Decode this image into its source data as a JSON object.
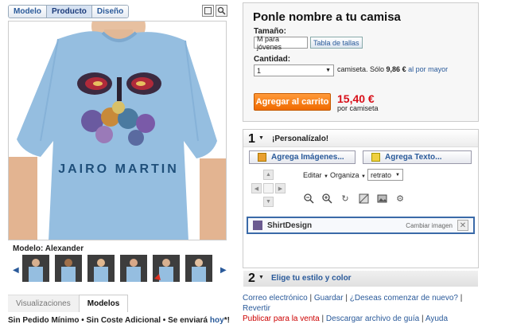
{
  "view_tabs": [
    "Modelo",
    "Producto",
    "Diseño"
  ],
  "view_icons": [
    "square-view-icon",
    "zoom-icon"
  ],
  "model_label": "Modelo: Alexander",
  "shirt_text": "JAIRO MARTIN",
  "bottom_tabs": [
    "Visualizaciones",
    "Modelos"
  ],
  "shipping": {
    "text": "Sin Pedido Mínimo • Sin Coste Adicional • Se enviará ",
    "link": "hoy",
    "tail": "*!"
  },
  "product": {
    "title": "Ponle nombre a tu camisa",
    "size_label": "Tamaño:",
    "size_value": "M para jóvenes",
    "size_chart": "Tabla de tallas",
    "qty_label": "Cantidad:",
    "qty_value": "1",
    "unit_text": "camiseta. Sólo",
    "bulk_price": "9,86 €",
    "bulk_link": "al por mayor",
    "cart_button": "Agregar al carrito",
    "price": "15,40 €",
    "price_unit": "por camiseta"
  },
  "customize": {
    "step": "1",
    "title": "¡Personalízalo!",
    "add_images": "Agrega Imágenes...",
    "add_text": "Agrega Texto...",
    "edit": "Editar",
    "organize": "Organiza",
    "fit_value": "retrato",
    "design_name": "ShirtDesign",
    "change_image": "Cambiar imagen"
  },
  "style": {
    "step": "2",
    "title": "Elige tu estilo y color"
  },
  "links": {
    "email": "Correo electrónico",
    "save": "Guardar",
    "new": "¿Deseas comenzar de nuevo?",
    "revert": "Revertir",
    "sell": "Publicar para la venta",
    "guide": "Descargar archivo de guía",
    "help": "Ayuda"
  }
}
